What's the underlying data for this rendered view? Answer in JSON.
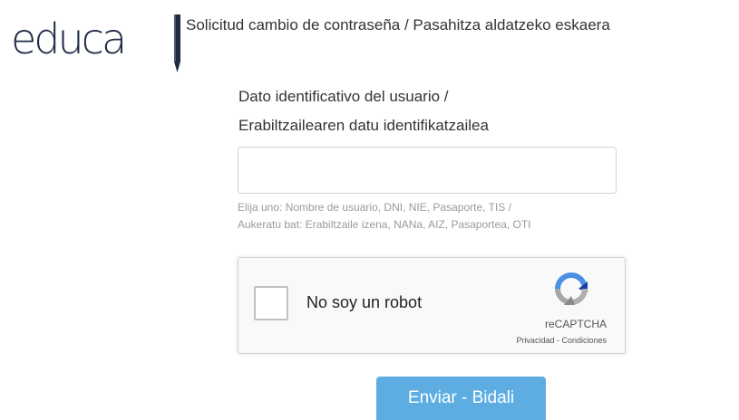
{
  "header": {
    "logo_text": "educa",
    "title": "Solicitud cambio de contraseña / Pasahitza aldatzeko eskaera"
  },
  "form": {
    "label_line1": "Dato identificativo del usuario /",
    "label_line2": "Erabiltzailearen datu identifikatzailea",
    "input_value": "",
    "help_line1": "Elija uno: Nombre de usuario, DNI, NIE, Pasaporte, TIS /",
    "help_line2": "Aukeratu bat: Erabiltzaile izena, NANa, AIZ, Pasaportea, OTI"
  },
  "captcha": {
    "label": "No soy un robot",
    "brand": "reCAPTCHA",
    "privacy": "Privacidad",
    "separator": " - ",
    "terms": "Condiciones",
    "checked": false
  },
  "submit": {
    "label": "Enviar - Bidali"
  },
  "colors": {
    "submit_bg": "#5dade2",
    "logo": "#1f2a44",
    "captcha_blue": "#4a90e2"
  },
  "icons": {
    "logo_pencil": "pencil-icon",
    "captcha_logo": "recaptcha-icon"
  }
}
